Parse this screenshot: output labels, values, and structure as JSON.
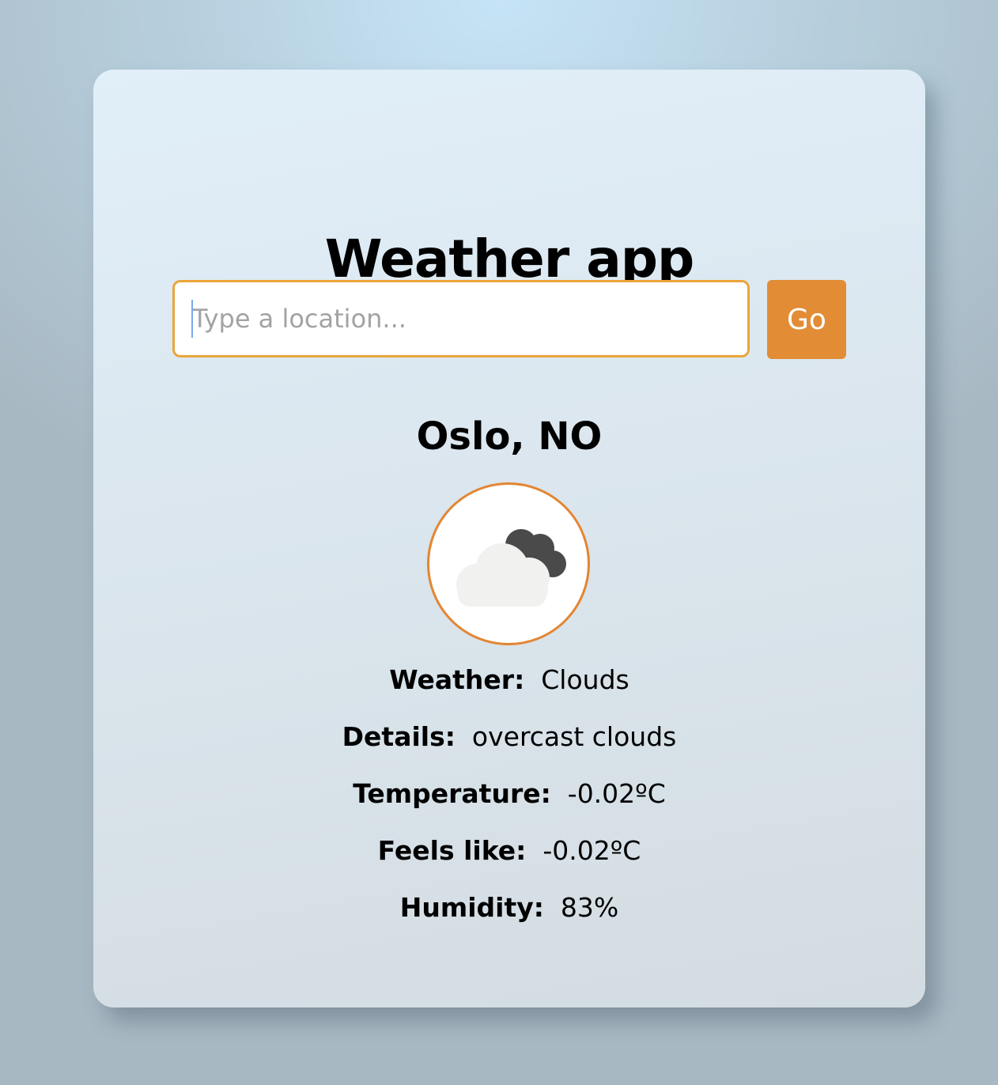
{
  "app": {
    "title": "Weather app"
  },
  "search": {
    "placeholder": "Type a location...",
    "value": "",
    "button_label": "Go"
  },
  "location": {
    "name": "Oslo, NO"
  },
  "weather_icon": {
    "name": "overcast-clouds-icon"
  },
  "details": [
    {
      "label": "Weather:",
      "value": "Clouds"
    },
    {
      "label": "Details:",
      "value": "overcast clouds"
    },
    {
      "label": "Temperature:",
      "value": "-0.02ºC"
    },
    {
      "label": "Feels like:",
      "value": "-0.02ºC"
    },
    {
      "label": "Humidity:",
      "value": "83%"
    }
  ],
  "colors": {
    "accent": "#e28d35",
    "input_border": "#eba53a",
    "icon_ring": "#e38634"
  }
}
